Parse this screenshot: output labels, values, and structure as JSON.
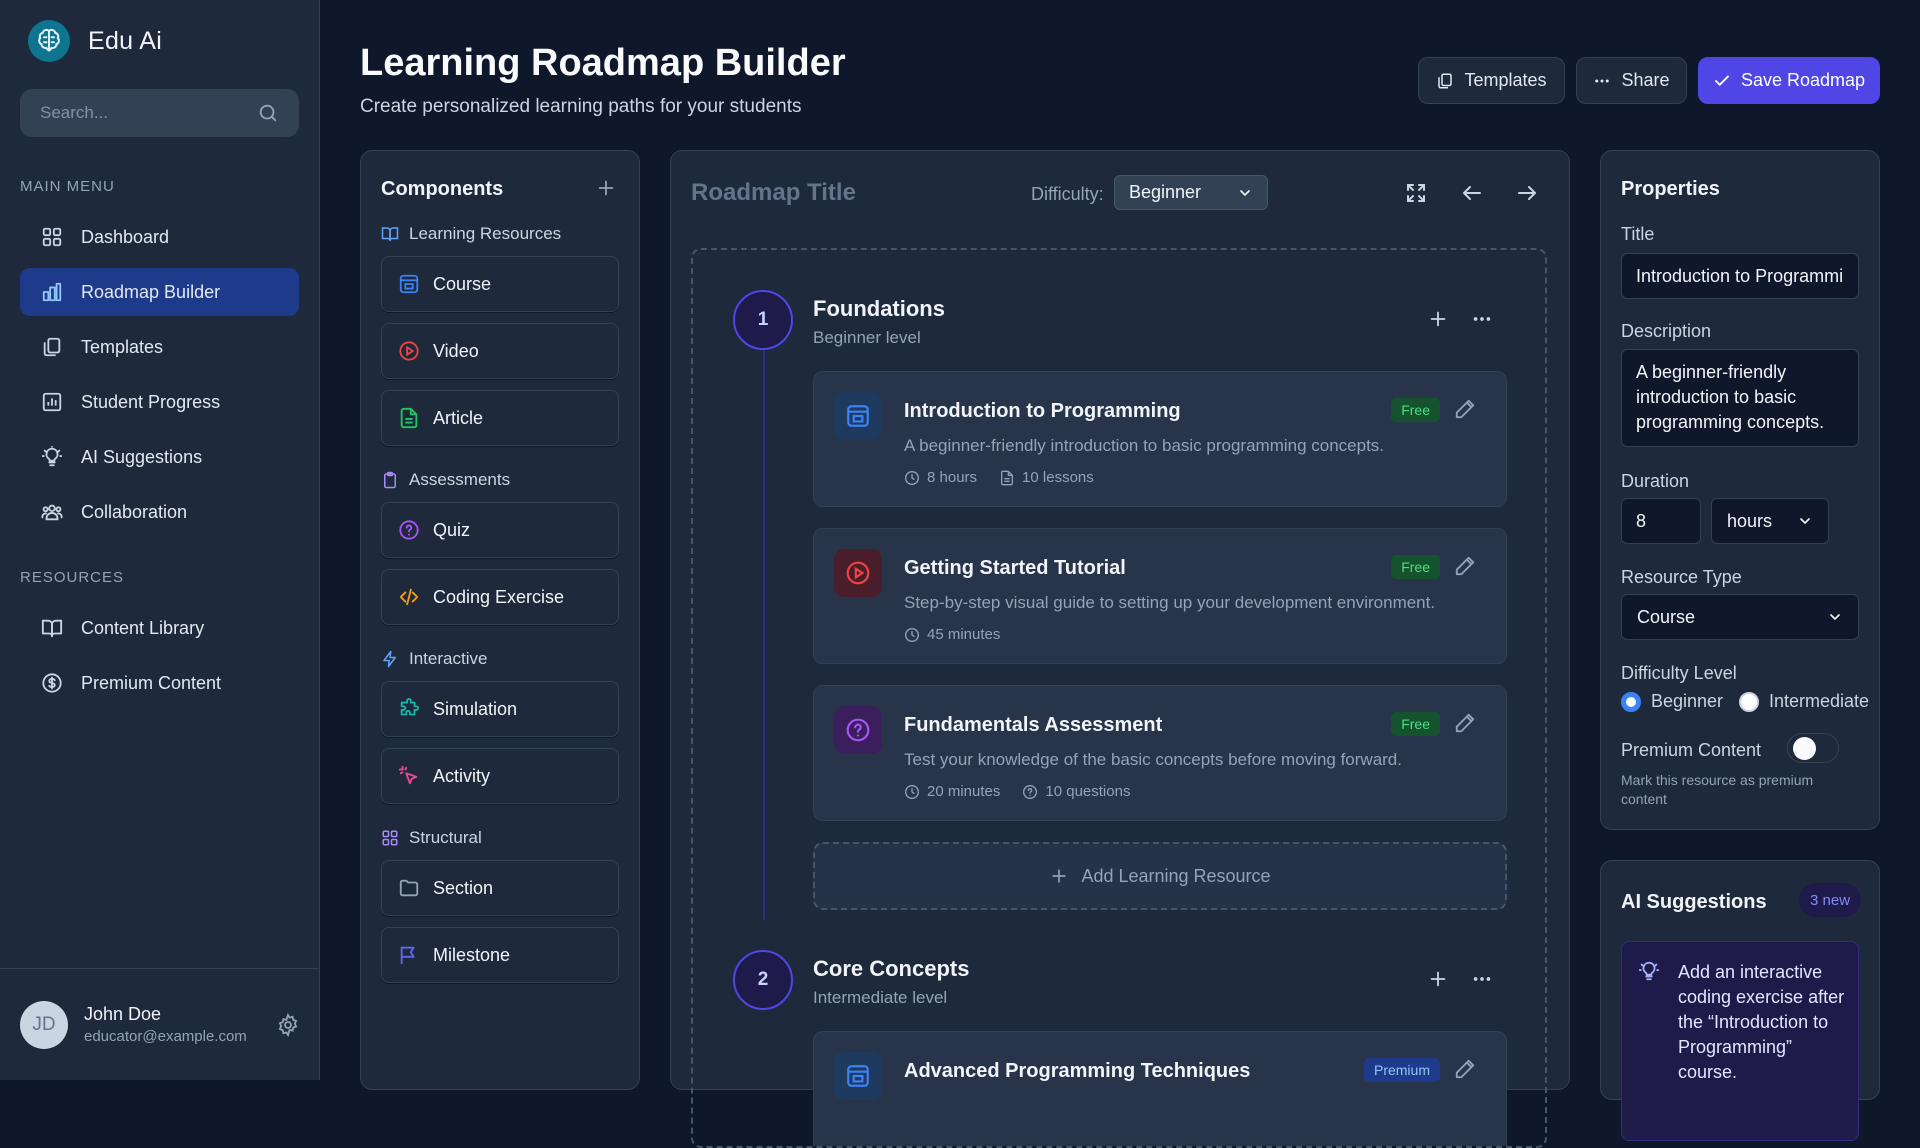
{
  "app": {
    "name": "Edu Ai"
  },
  "search": {
    "placeholder": "Search..."
  },
  "sidebar": {
    "main_menu_label": "MAIN MENU",
    "main_items": [
      {
        "label": "Dashboard",
        "icon": "grid-icon"
      },
      {
        "label": "Roadmap Builder",
        "icon": "bar-chart-icon",
        "active": true
      },
      {
        "label": "Templates",
        "icon": "copy-icon"
      },
      {
        "label": "Student Progress",
        "icon": "chart-icon"
      },
      {
        "label": "AI Suggestions",
        "icon": "lightbulb-icon"
      },
      {
        "label": "Collaboration",
        "icon": "users-icon"
      }
    ],
    "resources_label": "RESOURCES",
    "resource_items": [
      {
        "label": "Content Library",
        "icon": "book-icon"
      },
      {
        "label": "Premium Content",
        "icon": "dollar-icon"
      }
    ]
  },
  "user": {
    "initials": "JD",
    "name": "John Doe",
    "email": "educator@example.com"
  },
  "header": {
    "title": "Learning Roadmap Builder",
    "subtitle": "Create personalized learning paths for your students",
    "templates_label": "Templates",
    "share_label": "Share",
    "save_label": "Save Roadmap"
  },
  "components": {
    "title": "Components",
    "groups": [
      {
        "label": "Learning Resources",
        "items": [
          "Course",
          "Video",
          "Article"
        ]
      },
      {
        "label": "Assessments",
        "items": [
          "Quiz",
          "Coding Exercise"
        ]
      },
      {
        "label": "Interactive",
        "items": [
          "Simulation",
          "Activity"
        ]
      },
      {
        "label": "Structural",
        "items": [
          "Section",
          "Milestone"
        ]
      }
    ]
  },
  "roadmap": {
    "title": "Roadmap Title",
    "difficulty_label": "Difficulty:",
    "difficulty_value": "Beginner",
    "sections": [
      {
        "number": "1",
        "name": "Foundations",
        "level": "Beginner level",
        "resources": [
          {
            "title": "Introduction to Programming",
            "desc": "A beginner-friendly introduction to basic programming concepts.",
            "badge": "Free",
            "meta1": "8 hours",
            "meta2": "10 lessons",
            "type": "course"
          },
          {
            "title": "Getting Started Tutorial",
            "desc": "Step-by-step visual guide to setting up your development environment.",
            "badge": "Free",
            "meta1": "45 minutes",
            "type": "video"
          },
          {
            "title": "Fundamentals Assessment",
            "desc": "Test your knowledge of the basic concepts before moving forward.",
            "badge": "Free",
            "meta1": "20 minutes",
            "meta2": "10 questions",
            "type": "quiz"
          }
        ],
        "add_label": "Add Learning Resource"
      },
      {
        "number": "2",
        "name": "Core Concepts",
        "level": "Intermediate level",
        "resources": [
          {
            "title": "Advanced Programming Techniques",
            "badge": "Premium",
            "type": "course"
          }
        ]
      }
    ]
  },
  "properties": {
    "title": "Properties",
    "title_label": "Title",
    "title_value": "Introduction to Programming",
    "desc_label": "Description",
    "desc_value": "A beginner-friendly introduction to basic programming concepts.",
    "duration_label": "Duration",
    "duration_value": "8",
    "duration_unit": "hours",
    "type_label": "Resource Type",
    "type_value": "Course",
    "difficulty_label": "Difficulty Level",
    "difficulty_options": [
      "Beginner",
      "Intermediate"
    ],
    "difficulty_selected": "Beginner",
    "premium_label": "Premium Content",
    "premium_on": false,
    "premium_help": "Mark this resource as premium content"
  },
  "ai": {
    "title": "AI Suggestions",
    "badge": "3 new",
    "suggestion": "Add an interactive coding exercise after the “Introduction to Programming” course."
  },
  "colors": {
    "accent": "#4f46e5",
    "active_nav": "#1e3a8a",
    "free": "#4ade80",
    "premium": "#93c5fd"
  }
}
